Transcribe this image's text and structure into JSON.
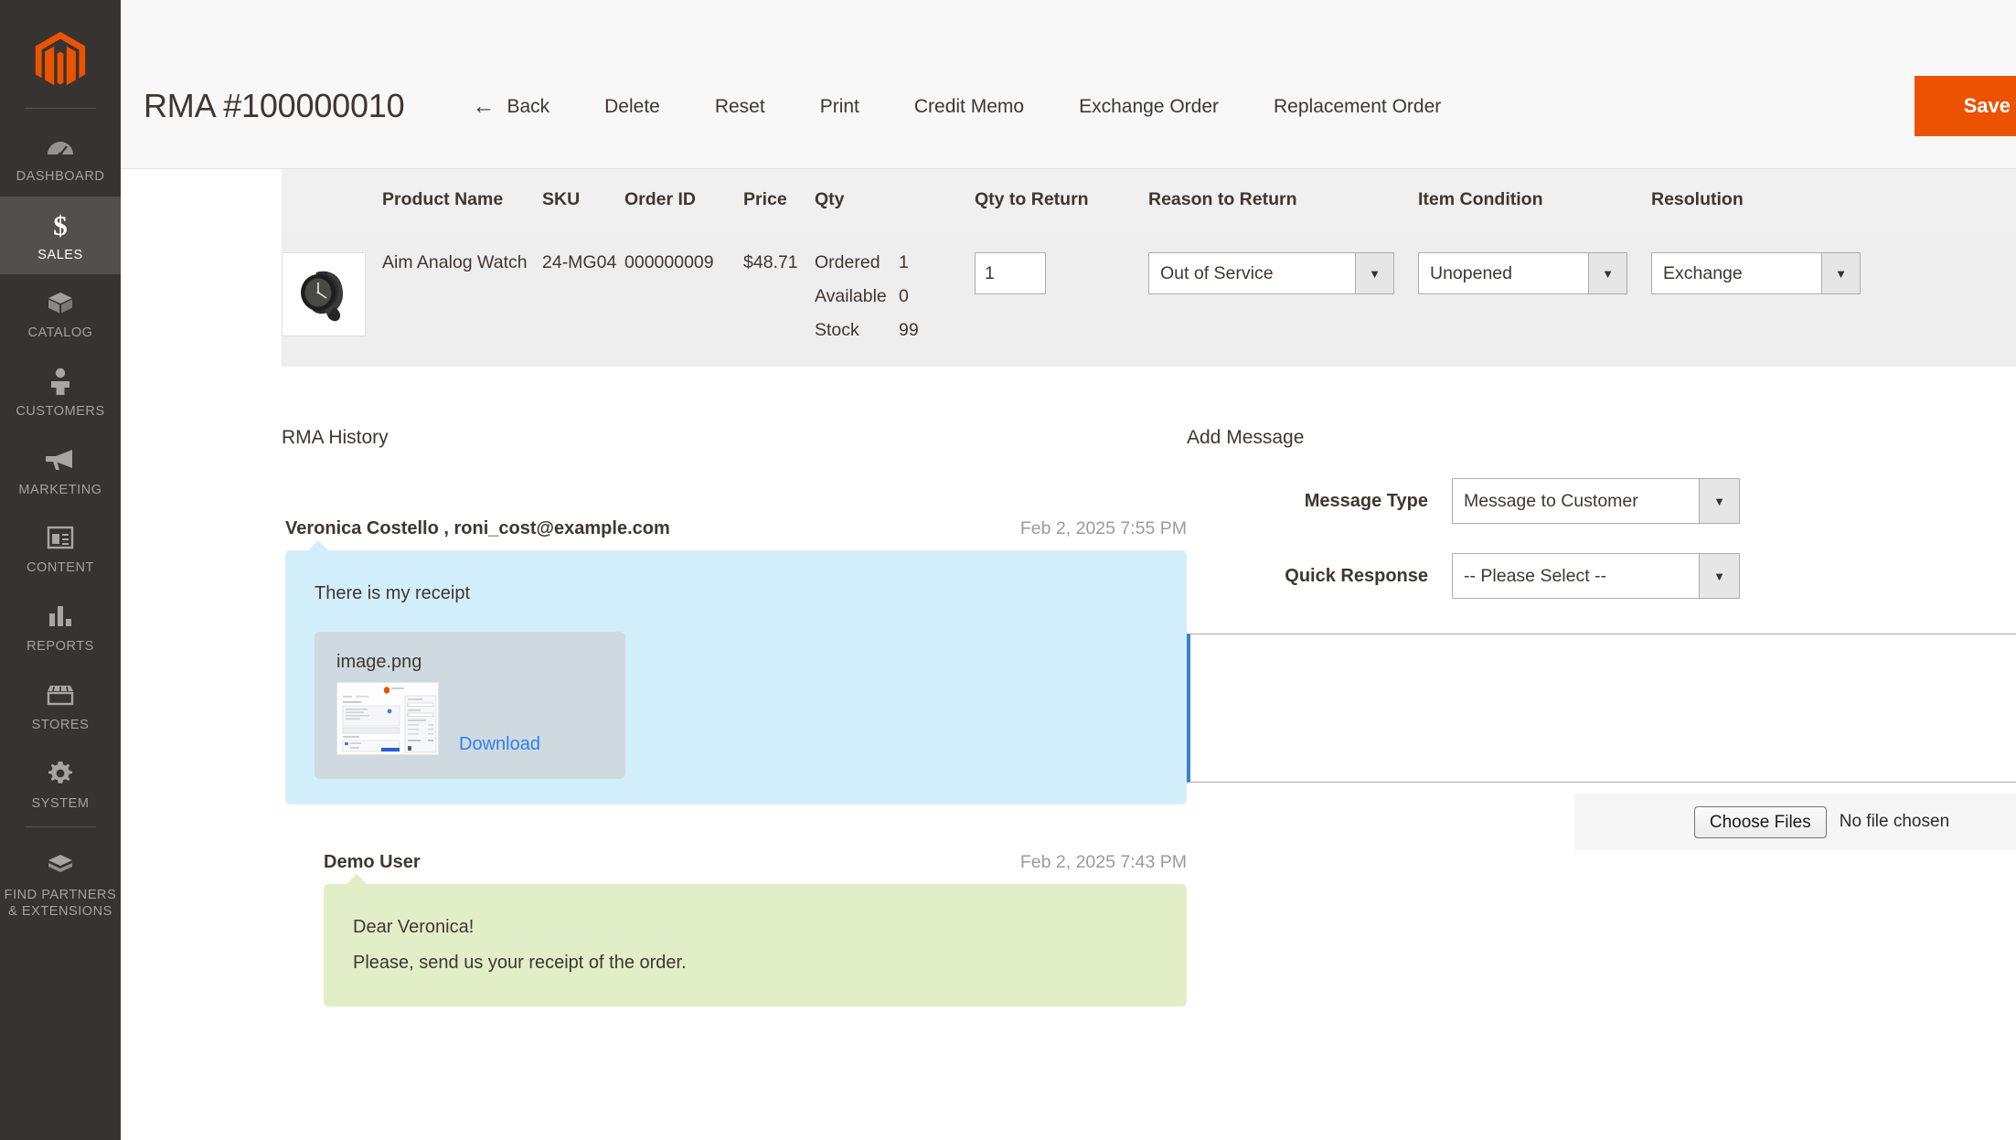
{
  "brand": {
    "logo": "magento-logo",
    "accent": "#eb5202"
  },
  "sidebar": {
    "items": [
      {
        "label": "DASHBOARD",
        "icon": "dashboard-icon",
        "active": false
      },
      {
        "label": "SALES",
        "icon": "dollar-icon",
        "active": true
      },
      {
        "label": "CATALOG",
        "icon": "box-icon",
        "active": false
      },
      {
        "label": "CUSTOMERS",
        "icon": "person-icon",
        "active": false
      },
      {
        "label": "MARKETING",
        "icon": "megaphone-icon",
        "active": false
      },
      {
        "label": "CONTENT",
        "icon": "layout-icon",
        "active": false
      },
      {
        "label": "REPORTS",
        "icon": "bar-chart-icon",
        "active": false
      },
      {
        "label": "STORES",
        "icon": "storefront-icon",
        "active": false
      },
      {
        "label": "SYSTEM",
        "icon": "gear-icon",
        "active": false
      },
      {
        "label": "FIND PARTNERS\n& EXTENSIONS",
        "icon": "partners-box-icon",
        "active": false
      }
    ],
    "partners_line1": "FIND PARTNERS",
    "partners_line2": "& EXTENSIONS"
  },
  "header": {
    "title": "RMA #100000010",
    "back_label": "Back",
    "back_icon": "arrow-left-icon",
    "buttons": [
      {
        "label": "Delete"
      },
      {
        "label": "Reset"
      },
      {
        "label": "Print"
      },
      {
        "label": "Credit Memo"
      },
      {
        "label": "Exchange Order"
      },
      {
        "label": "Replacement Order"
      }
    ],
    "save_label": "Save",
    "save_caret_icon": "chevron-down-icon"
  },
  "items_table": {
    "columns": [
      "",
      "Product Name",
      "SKU",
      "Order ID",
      "Price",
      "Qty",
      "Qty to Return",
      "Reason to Return",
      "Item Condition",
      "Resolution"
    ],
    "rows": [
      {
        "thumbnail": "product-thumbnail-watch",
        "product_name": "Aim Analog Watch",
        "sku": "24-MG04",
        "order_id": "000000009",
        "price": "$48.71",
        "qty": [
          {
            "key": "Ordered",
            "value": "1"
          },
          {
            "key": "Available",
            "value": "0"
          },
          {
            "key": "Stock",
            "value": "99"
          }
        ],
        "qty_to_return": "1",
        "reason_to_return": "Out of Service",
        "item_condition": "Unopened",
        "resolution": "Exchange"
      }
    ]
  },
  "history": {
    "title": "RMA History",
    "messages": [
      {
        "author": "Veronica Costello , roni_cost@example.com",
        "date": "Feb 2, 2025 7:55 PM",
        "body": "There is my receipt",
        "style": "customer",
        "attachment": {
          "filename": "image.png",
          "thumbnail": "attachment-thumbnail-checkout",
          "download_label": "Download"
        }
      },
      {
        "author": "Demo User",
        "date": "Feb 2, 2025 7:43 PM",
        "body_lines": [
          "Dear Veronica!",
          "Please, send us your receipt of the order."
        ],
        "style": "admin"
      }
    ]
  },
  "add_message": {
    "title": "Add Message",
    "message_type_label": "Message Type",
    "message_type_value": "Message to Customer",
    "quick_response_label": "Quick Response",
    "quick_response_value": "-- Please Select --",
    "textarea_value": "",
    "textarea_placeholder": "",
    "choose_files_label": "Choose Files",
    "no_file_label": "No file chosen"
  }
}
